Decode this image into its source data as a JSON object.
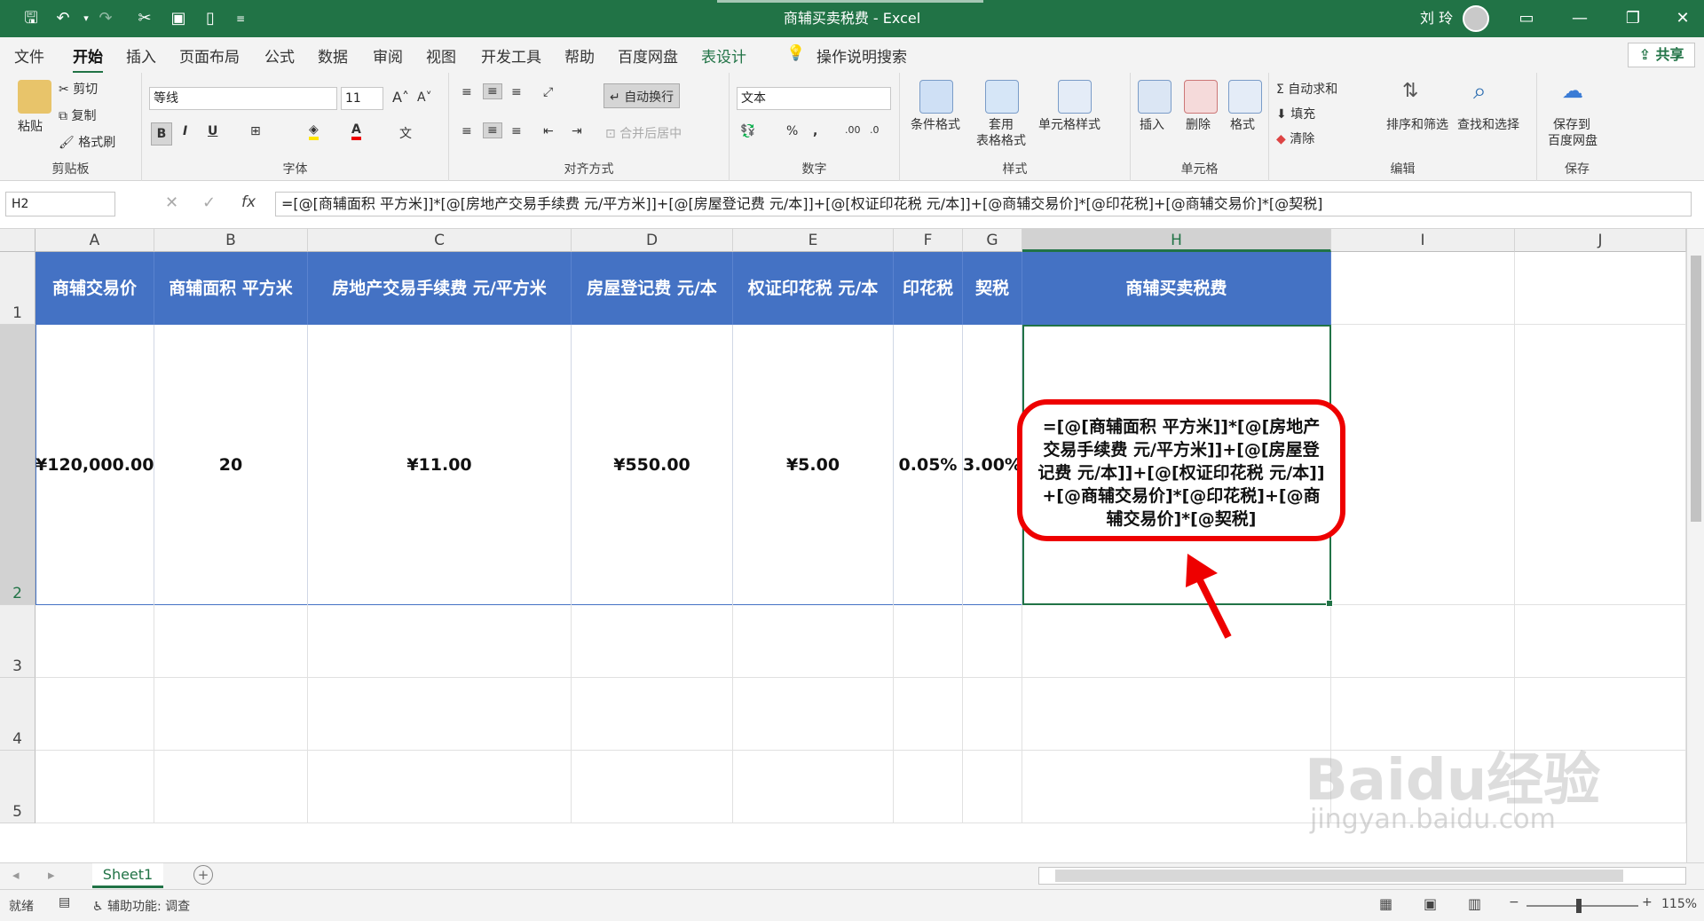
{
  "app": {
    "window_title": "商辅买卖税费 - Excel",
    "user": "刘 玲",
    "share_label": "共享"
  },
  "tabs": [
    "文件",
    "开始",
    "插入",
    "页面布局",
    "公式",
    "数据",
    "审阅",
    "视图",
    "开发工具",
    "帮助",
    "百度网盘",
    "表设计"
  ],
  "tell_me": "操作说明搜索",
  "ribbon": {
    "clipboard": {
      "paste": "粘贴",
      "cut": "剪切",
      "copy": "复制",
      "format_painter": "格式刷",
      "label": "剪贴板"
    },
    "font": {
      "name": "等线",
      "size": "11",
      "label": "字体"
    },
    "alignment": {
      "wrap": "自动换行",
      "merge": "合并后居中",
      "label": "对齐方式"
    },
    "number": {
      "format": "文本",
      "label": "数字"
    },
    "styles": {
      "conditional": "条件格式",
      "table_line1": "套用",
      "table_line2": "表格格式",
      "cell_styles": "单元格样式",
      "label": "样式"
    },
    "cells": {
      "insert": "插入",
      "delete": "删除",
      "format": "格式",
      "label": "单元格"
    },
    "editing": {
      "autosum": "自动求和",
      "fill": "填充",
      "clear": "清除",
      "sort": "排序和筛选",
      "find": "查找和选择",
      "label": "编辑"
    },
    "save": {
      "line1": "保存到",
      "line2": "百度网盘",
      "label": "保存"
    }
  },
  "formula_bar": {
    "name_box": "H2",
    "fx": "fx",
    "formula": "=[@[商辅面积 平方米]]*[@[房地产交易手续费 元/平方米]]+[@[房屋登记费 元/本]]+[@[权证印花税 元/本]]+[@商辅交易价]*[@印花税]+[@商辅交易价]*[@契税]"
  },
  "columns": [
    "A",
    "B",
    "C",
    "D",
    "E",
    "F",
    "G",
    "H",
    "I",
    "J"
  ],
  "rows": [
    "1",
    "2",
    "3",
    "4",
    "5"
  ],
  "table": {
    "headers": [
      "商辅交易价",
      "商辅面积 平方米",
      "房地产交易手续费 元/平方米",
      "房屋登记费 元/本",
      "权证印花税 元/本",
      "印花税",
      "契税",
      "商辅买卖税费"
    ],
    "row": [
      "¥120,000.00",
      "20",
      "¥11.00",
      "¥550.00",
      "¥5.00",
      "0.05%",
      "3.00%"
    ]
  },
  "callout": "=[@[商辅面积 平方米]]*[@[房地产交易手续费 元/平方米]]+[@[房屋登记费 元/本]]+[@[权证印花税 元/本]]+[@商辅交易价]*[@印花税]+[@商辅交易价]*[@契税]",
  "sheet_tab": "Sheet1",
  "status": {
    "ready": "就绪",
    "accessibility": "辅助功能: 调查",
    "zoom": "115%"
  },
  "watermark": {
    "brand": "Baidu经验",
    "url": "jingyan.baidu.com"
  },
  "colors": {
    "excel_green": "#217346",
    "table_header": "#4472c4",
    "callout_red": "#ee0000"
  }
}
